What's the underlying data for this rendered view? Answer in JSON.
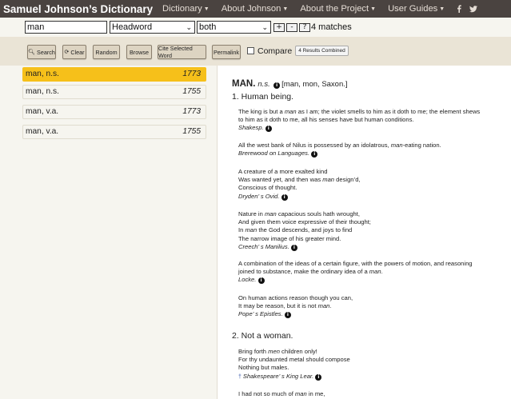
{
  "nav": {
    "brand": "Samuel Johnson’s Dictionary",
    "items": [
      {
        "label": "Dictionary"
      },
      {
        "label": "About Johnson"
      },
      {
        "label": "About the Project"
      },
      {
        "label": "User Guides"
      }
    ],
    "social_icons": [
      "facebook-icon",
      "twitter-icon"
    ]
  },
  "search": {
    "query": "man",
    "field": "Headword",
    "edition": "both",
    "zoom_plus": "+",
    "zoom_minus": "-",
    "help": "?",
    "matches": "4 matches"
  },
  "toolbar": {
    "search": "Search",
    "clear": "Clear",
    "random": "Random",
    "browse": "Browse",
    "cite": "Cite Selected Word",
    "permalink": "Permalink",
    "compare_label": "Compare",
    "compare_checked": false,
    "badge": "4 Results Combined"
  },
  "results": [
    {
      "headword": "man, n.s.",
      "year": "1773",
      "selected": true
    },
    {
      "headword": "man, n.s.",
      "year": "1755",
      "selected": false
    },
    {
      "headword": "man, v.a.",
      "year": "1773",
      "selected": false
    },
    {
      "headword": "man, v.a.",
      "year": "1755",
      "selected": false
    }
  ],
  "entry": {
    "headword": "MAN.",
    "pos": "n.s.",
    "etymology": "[man, mon, Saxon.]",
    "senses": [
      {
        "label": "1. Human being.",
        "quotes": [
          {
            "lines": [
              "The king is but a man as I am; the violet smells to him as it doth to me; the element shews",
              "to him as it doth to me, all his senses have but human conditions."
            ],
            "source": "Shakesp."
          },
          {
            "lines": [
              "All the west bank of Nilus is possessed by an idolatrous, man-eating nation."
            ],
            "source": "Brerewood on Languages."
          },
          {
            "lines": [
              "A creature of a more exalted kind",
              "Was wanted yet, and then was man design’d,",
              "Conscious of thought."
            ],
            "source": "Dryden’ s Ovid."
          },
          {
            "lines": [
              "Nature in man capacious souls hath wrought,",
              "And given them voice expressive of their thought;",
              "In man the God descends, and joys to find",
              "The narrow image of his greater mind."
            ],
            "source": "Creech’ s Manilius."
          },
          {
            "lines": [
              "A combination of the ideas of a certain figure, with the powers of motion, and reasoning",
              "joined to substance, make the ordinary idea of a man."
            ],
            "source": "Locke."
          },
          {
            "lines": [
              "On human actions reason though you can,",
              "It may be reason, but it is not man."
            ],
            "source": "Pope’ s Epistles."
          }
        ]
      },
      {
        "label": "2. Not a woman.",
        "quotes": [
          {
            "lines": [
              "Bring forth men children only!",
              "For thy undaunted metal should compose",
              "Nothing but males."
            ],
            "source": "Shakespeare’ s King Lear.",
            "dagger": "†"
          },
          {
            "lines": [
              "I had not so much of man in me,"
            ],
            "source": ""
          }
        ]
      }
    ]
  },
  "colors": {
    "nav_bg": "#4a4340",
    "toolbar_bg": "#eae4d6",
    "pane_bg": "#f6f5ef",
    "selected": "#f6c01a"
  }
}
